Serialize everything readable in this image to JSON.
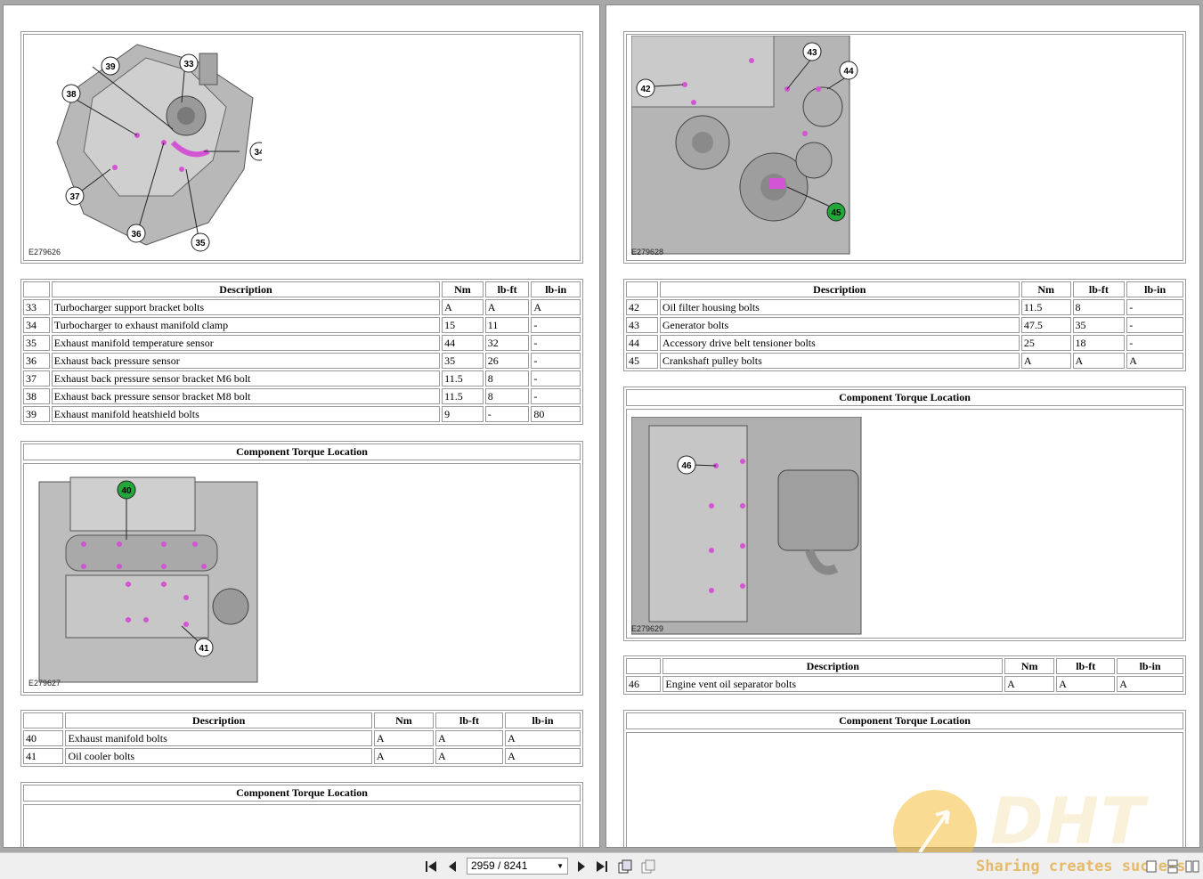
{
  "left_page": {
    "fig1_code": "E279626",
    "fig1_callouts": [
      "39",
      "33",
      "38",
      "34",
      "37",
      "36",
      "35"
    ],
    "table1": {
      "headers": [
        "",
        "Description",
        "Nm",
        "lb-ft",
        "lb-in"
      ],
      "rows": [
        [
          "33",
          "Turbocharger support bracket bolts",
          "A",
          "A",
          "A"
        ],
        [
          "34",
          "Turbocharger to exhaust manifold clamp",
          "15",
          "11",
          "-"
        ],
        [
          "35",
          "Exhaust manifold temperature sensor",
          "44",
          "32",
          "-"
        ],
        [
          "36",
          "Exhaust back pressure sensor",
          "35",
          "26",
          "-"
        ],
        [
          "37",
          "Exhaust back pressure sensor bracket M6 bolt",
          "11.5",
          "8",
          "-"
        ],
        [
          "38",
          "Exhaust back pressure sensor bracket M8 bolt",
          "11.5",
          "8",
          "-"
        ],
        [
          "39",
          "Exhaust manifold heatshield bolts",
          "9",
          "-",
          "80"
        ]
      ]
    },
    "section2_title": "Component Torque Location",
    "fig2_code": "E279627",
    "fig2_callouts": [
      "40",
      "41"
    ],
    "table2": {
      "headers": [
        "",
        "Description",
        "Nm",
        "lb-ft",
        "lb-in"
      ],
      "rows": [
        [
          "40",
          "Exhaust manifold bolts",
          "A",
          "A",
          "A"
        ],
        [
          "41",
          "Oil cooler bolts",
          "A",
          "A",
          "A"
        ]
      ]
    },
    "section3_title": "Component Torque Location"
  },
  "right_page": {
    "fig1_code": "E279628",
    "fig1_callouts": [
      "43",
      "44",
      "42",
      "45"
    ],
    "table1": {
      "headers": [
        "",
        "Description",
        "Nm",
        "lb-ft",
        "lb-in"
      ],
      "rows": [
        [
          "42",
          "Oil filter housing bolts",
          "11.5",
          "8",
          "-"
        ],
        [
          "43",
          "Generator bolts",
          "47.5",
          "35",
          "-"
        ],
        [
          "44",
          "Accessory drive belt tensioner bolts",
          "25",
          "18",
          "-"
        ],
        [
          "45",
          "Crankshaft pulley bolts",
          "A",
          "A",
          "A"
        ]
      ]
    },
    "section2_title": "Component Torque Location",
    "fig2_code": "E279629",
    "fig2_callouts": [
      "46"
    ],
    "table2": {
      "headers": [
        "",
        "Description",
        "Nm",
        "lb-ft",
        "lb-in"
      ],
      "rows": [
        [
          "46",
          "Engine vent oil separator bolts",
          "A",
          "A",
          "A"
        ]
      ]
    },
    "section3_title": "Component Torque Location"
  },
  "toolbar": {
    "page_indicator": "2959 / 8241",
    "icons": [
      "first-page-icon",
      "prev-page-icon",
      "next-page-icon",
      "last-page-icon",
      "single-page-view-icon",
      "two-page-view-icon"
    ]
  },
  "watermark": {
    "logo_text": "DHT",
    "tagline": "Sharing creates success"
  },
  "colors": {
    "callout_highlight": "#22a83a",
    "bolt_marker": "#d455d4",
    "background": "#a8a8a8"
  }
}
